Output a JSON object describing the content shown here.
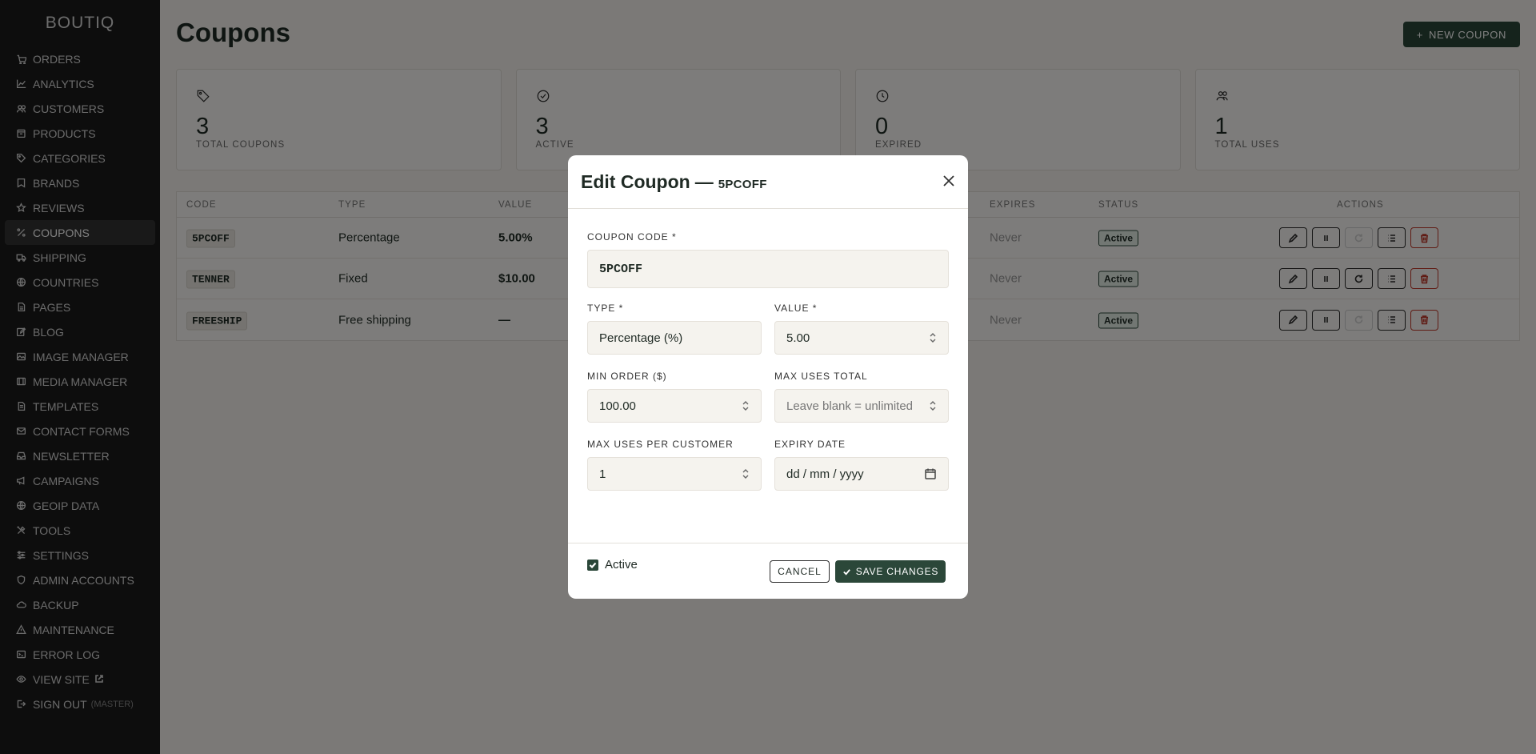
{
  "sidebar": {
    "brand": "BOUTIQ",
    "items": [
      {
        "label": "ORDERS",
        "icon": "cart-icon"
      },
      {
        "label": "ANALYTICS",
        "icon": "chart-line-icon"
      },
      {
        "label": "CUSTOMERS",
        "icon": "users-icon"
      },
      {
        "label": "PRODUCTS",
        "icon": "box-icon"
      },
      {
        "label": "CATEGORIES",
        "icon": "tag-icon"
      },
      {
        "label": "BRANDS",
        "icon": "bookmark-icon"
      },
      {
        "label": "REVIEWS",
        "icon": "star-icon"
      },
      {
        "label": "COUPONS",
        "icon": "percent-icon"
      },
      {
        "label": "SHIPPING",
        "icon": "truck-icon"
      },
      {
        "label": "COUNTRIES",
        "icon": "globe-icon"
      },
      {
        "label": "PAGES",
        "icon": "file-icon"
      },
      {
        "label": "BLOG",
        "icon": "edit-icon"
      },
      {
        "label": "IMAGE MANAGER",
        "icon": "image-icon"
      },
      {
        "label": "MEDIA MANAGER",
        "icon": "film-icon"
      },
      {
        "label": "TEMPLATES",
        "icon": "document-icon"
      },
      {
        "label": "CONTACT FORMS",
        "icon": "mail-icon"
      },
      {
        "label": "NEWSLETTER",
        "icon": "inbox-icon"
      },
      {
        "label": "CAMPAIGNS",
        "icon": "megaphone-icon"
      },
      {
        "label": "GEOIP DATA",
        "icon": "globe-icon"
      },
      {
        "label": "TOOLS",
        "icon": "tools-icon"
      },
      {
        "label": "SETTINGS",
        "icon": "sliders-icon"
      },
      {
        "label": "ADMIN ACCOUNTS",
        "icon": "shield-icon"
      },
      {
        "label": "BACKUP",
        "icon": "cloud-icon"
      },
      {
        "label": "MAINTENANCE",
        "icon": "warning-icon"
      },
      {
        "label": "ERROR LOG",
        "icon": "terminal-icon"
      },
      {
        "label": "VIEW SITE",
        "icon": "eye-icon"
      },
      {
        "label": "SIGN OUT",
        "sub": "(MASTER)",
        "icon": "logout-icon"
      }
    ],
    "active_index": 7
  },
  "header": {
    "title": "Coupons",
    "new_button": "NEW COUPON"
  },
  "stats": [
    {
      "value": "3",
      "label": "TOTAL COUPONS",
      "icon": "tag-icon"
    },
    {
      "value": "3",
      "label": "ACTIVE",
      "icon": "check-circle-icon"
    },
    {
      "value": "0",
      "label": "EXPIRED",
      "icon": "clock-icon"
    },
    {
      "value": "1",
      "label": "TOTAL USES",
      "icon": "users-icon"
    }
  ],
  "table": {
    "columns": {
      "code": "CODE",
      "type": "TYPE",
      "value": "VALUE",
      "expires": "EXPIRES",
      "status": "STATUS",
      "actions": "ACTIONS"
    },
    "rows": [
      {
        "code": "5PCOFF",
        "type": "Percentage",
        "value": "5.00%",
        "expires": "Never",
        "status": "Active",
        "reset_disabled": true
      },
      {
        "code": "TENNER",
        "type": "Fixed",
        "value": "$10.00",
        "expires": "Never",
        "status": "Active",
        "reset_disabled": false
      },
      {
        "code": "FREESHIP",
        "type": "Free shipping",
        "value": "—",
        "expires": "Never",
        "status": "Active",
        "reset_disabled": true
      }
    ]
  },
  "modal": {
    "title": "Edit Coupon",
    "separator": "—",
    "code": "5PCOFF",
    "fields": {
      "code_label": "COUPON CODE *",
      "code_value": "5PCOFF",
      "type_label": "TYPE *",
      "type_value": "Percentage (%)",
      "value_label": "VALUE *",
      "value_value": "5.00",
      "min_order_label": "MIN ORDER ($)",
      "min_order_value": "100.00",
      "max_uses_label": "MAX USES TOTAL",
      "max_uses_placeholder": "Leave blank = unlimited",
      "max_per_customer_label": "MAX USES PER CUSTOMER",
      "max_per_customer_value": "1",
      "expiry_label": "EXPIRY DATE",
      "expiry_placeholder": "dd / mm / yyyy"
    },
    "active_label": "Active",
    "active_checked": true,
    "cancel_label": "CANCEL",
    "save_label": "SAVE CHANGES"
  }
}
